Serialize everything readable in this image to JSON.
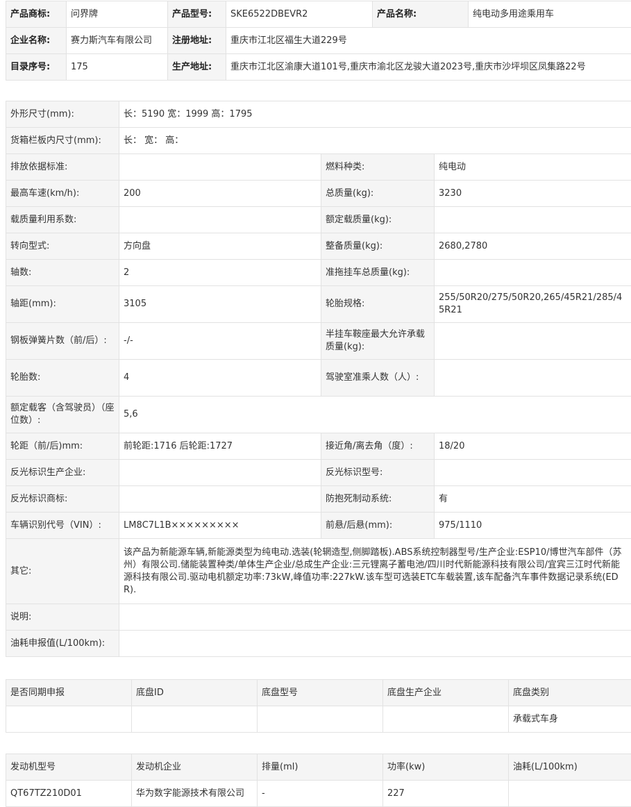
{
  "header": {
    "brand_label": "产品商标:",
    "brand": "问界牌",
    "model_label": "产品型号:",
    "model": "SKE6522DBEVR2",
    "name_label": "产品名称:",
    "name": "纯电动多用途乘用车",
    "company_label": "企业名称:",
    "company": "赛力斯汽车有限公司",
    "reg_addr_label": "注册地址:",
    "reg_addr": "重庆市江北区福生大道229号",
    "catalog_label": "目录序号:",
    "catalog": "175",
    "prod_addr_label": "生产地址:",
    "prod_addr": "重庆市江北区渝康大道101号,重庆市渝北区龙骏大道2023号,重庆市沙坪坝区凤集路22号"
  },
  "specs": {
    "dims_label": "外形尺寸(mm):",
    "dims": "长：5190 宽：1999 高：1795",
    "cargo_label": "货箱栏板内尺寸(mm):",
    "cargo": "长：  宽：  高：",
    "emission_label": "排放依据标准:",
    "emission": "",
    "fuel_label": "燃料种类:",
    "fuel": "纯电动",
    "speed_label": "最高车速(km/h):",
    "speed": "200",
    "mass_label": "总质量(kg):",
    "mass": "3230",
    "load_coef_label": "载质量利用系数:",
    "load_coef": "",
    "rated_load_label": "额定载质量(kg):",
    "rated_load": "",
    "steering_label": "转向型式:",
    "steering": "方向盘",
    "curb_label": "整备质量(kg):",
    "curb": "2680,2780",
    "axles_label": "轴数:",
    "axles": "2",
    "trailer_label": "准拖挂车总质量(kg):",
    "trailer": "",
    "wheelbase_label": "轴距(mm):",
    "wheelbase": "3105",
    "tire_spec_label": "轮胎规格:",
    "tire_spec": "255/50R20/275/50R20,265/45R21/285/45R21",
    "spring_label": "钢板弹簧片数（前/后）:",
    "spring": "-/-",
    "semitrailer_label": "半挂车鞍座最大允许承载质量(kg):",
    "semitrailer": "",
    "tires_label": "轮胎数:",
    "tires": "4",
    "cab_label": "驾驶室准乘人数（人）:",
    "cab": "",
    "seats_label": "额定载客（含驾驶员）（座位数）:",
    "seats": "5,6",
    "track_label": "轮距（前/后)mm:",
    "track": "前轮距:1716 后轮距:1727",
    "angle_label": "接近角/离去角（度）:",
    "angle": "18/20",
    "refl_maker_label": "反光标识生产企业:",
    "refl_maker": "",
    "refl_model_label": "反光标识型号:",
    "refl_model": "",
    "refl_brand_label": "反光标识商标:",
    "refl_brand": "",
    "abs_label": "防抱死制动系统:",
    "abs": "有",
    "vin_label": "车辆识别代号（VIN）:",
    "vin": "LM8C7L1B×××××××××",
    "overhang_label": "前悬/后悬(mm):",
    "overhang": "975/1110",
    "other_label": "其它:",
    "other": "该产品为新能源车辆,新能源类型为纯电动.选装(轮辋造型,侧脚踏板).ABS系统控制器型号/生产企业:ESP10/博世汽车部件（苏州）有限公司.储能装置种类/单体生产企业/总成生产企业:三元锂离子蓄电池/四川时代新能源科技有限公司/宜宾三江时代新能源科技有限公司.驱动电机额定功率:73kW,峰值功率:227kW.该车型可选装ETC车载装置,该车配备汽车事件数据记录系统(EDR).",
    "note_label": "说明:",
    "note": "",
    "fuel_cons_label": "油耗申报值(L/100km):",
    "fuel_cons": ""
  },
  "chassis": {
    "headers": [
      "是否同期申报",
      "底盘ID",
      "底盘型号",
      "底盘生产企业",
      "底盘类别"
    ],
    "row": [
      "",
      "",
      "",
      "",
      "承载式车身"
    ]
  },
  "engine": {
    "headers": [
      "发动机型号",
      "发动机企业",
      "排量(ml)",
      "功率(kw)",
      "油耗(L/100km)"
    ],
    "row": [
      "QT67TZ210D01",
      "华为数字能源技术有限公司",
      "-",
      "227",
      ""
    ]
  }
}
